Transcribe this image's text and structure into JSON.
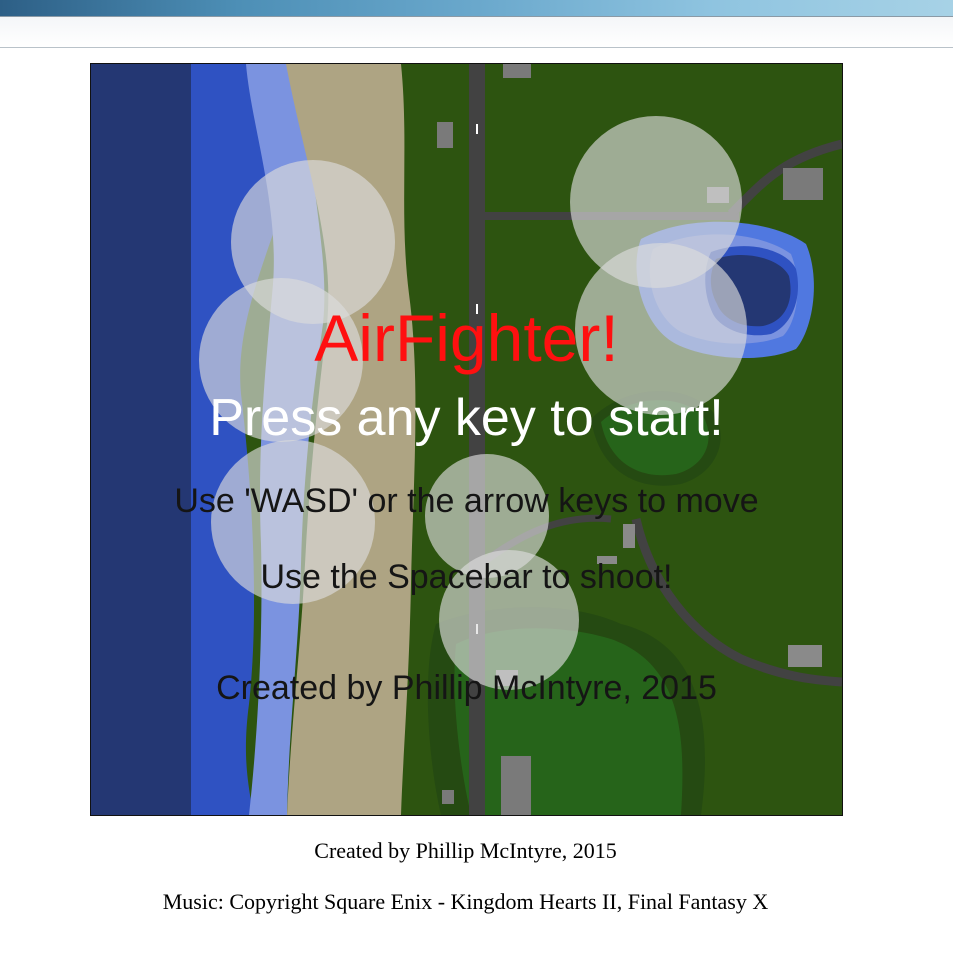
{
  "game": {
    "title": "AirFighter!",
    "start_prompt": "Press any key to start!",
    "move_instructions": "Use 'WASD' or the arrow keys to move",
    "shoot_instructions": "Use the Spacebar to shoot!",
    "credit": "Created by Phillip McIntyre, 2015",
    "colors": {
      "title": "#ff1010",
      "prompt": "#ffffff",
      "instructions": "#151515",
      "deep_sea": "#243773",
      "shallow_sea": "#2f52c2",
      "surf": "#7b93e0",
      "sand": "#aea483",
      "grass": "#2d5410",
      "forest": "#26641a",
      "road": "#424242",
      "cloud": "rgba(220,220,220,0.65)"
    }
  },
  "footer": {
    "credit": "Created by Phillip McIntyre, 2015",
    "music": "Music: Copyright Square Enix - Kingdom Hearts II, Final Fantasy X"
  }
}
